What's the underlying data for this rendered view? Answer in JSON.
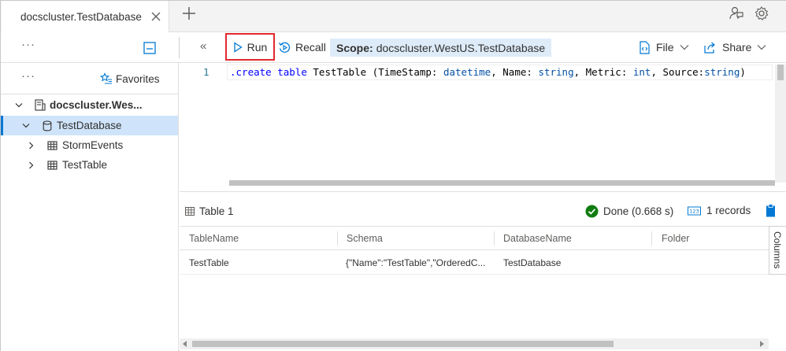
{
  "tab": {
    "label": "docscluster.TestDatabase"
  },
  "toolbar": {
    "run_label": "Run",
    "recall_label": "Recall",
    "scope_prefix": "Scope:",
    "scope_value": "docscluster.WestUS.TestDatabase",
    "file_label": "File",
    "share_label": "Share"
  },
  "left_panel": {
    "favorites_label": "Favorites",
    "tree": [
      {
        "label": "docscluster.Wes...",
        "bold": true
      },
      {
        "label": "TestDatabase",
        "selected": true
      },
      {
        "label": "StormEvents"
      },
      {
        "label": "TestTable"
      }
    ]
  },
  "editor": {
    "line_number": "1",
    "tokens": {
      "create": ".create",
      "table": "table",
      "name": "TestTable",
      "open": " (",
      "f1": "TimeStamp",
      "t1": "datetime",
      "f2": "Name",
      "t2": "string",
      "f3": "Metric",
      "t3": "int",
      "f4": "Source",
      "t4": "string",
      "close": ")"
    }
  },
  "results": {
    "title": "Table 1",
    "status": "Done (0.668 s)",
    "records": "1 records",
    "columns_tab": "Columns",
    "headers": [
      "TableName",
      "Schema",
      "DatabaseName",
      "Folder"
    ],
    "rows": [
      [
        "TestTable",
        "{\"Name\":\"TestTable\",\"OrderedC...",
        "TestDatabase",
        ""
      ]
    ]
  },
  "colors": {
    "accent": "#0078d4",
    "run_highlight": "#e02a2f",
    "success": "#107c10",
    "scope_bg": "#deecf9",
    "selected_bg": "#cfe4fa"
  }
}
